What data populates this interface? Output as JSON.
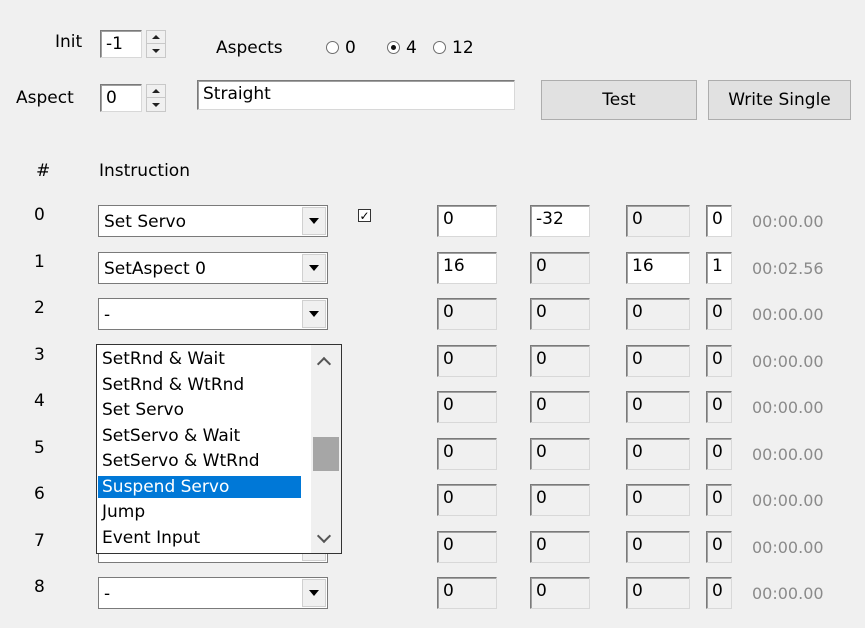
{
  "init": {
    "label": "Init",
    "value": "-1"
  },
  "aspects": {
    "label": "Aspects",
    "options": [
      {
        "label": "0",
        "selected": false
      },
      {
        "label": "4",
        "selected": true
      },
      {
        "label": "12",
        "selected": false
      }
    ]
  },
  "aspect": {
    "label": "Aspect",
    "value": "0",
    "name": "Straight"
  },
  "buttons": {
    "test": "Test",
    "write_single": "Write Single"
  },
  "headers": {
    "num": "#",
    "instruction": "Instruction"
  },
  "rows": [
    {
      "num": "0",
      "instruction": "Set Servo",
      "checkbox": true,
      "v1": "0",
      "v2": "-32",
      "v3": "0",
      "v4": "0",
      "v1_ro": false,
      "v2_ro": false,
      "v3_ro": true,
      "v4_ro": false,
      "time": "00:00.00"
    },
    {
      "num": "1",
      "instruction": "SetAspect 0",
      "checkbox": false,
      "v1": "16",
      "v2": "0",
      "v3": "16",
      "v4": "1",
      "v1_ro": false,
      "v2_ro": true,
      "v3_ro": false,
      "v4_ro": false,
      "time": "00:02.56"
    },
    {
      "num": "2",
      "instruction": "-",
      "checkbox": false,
      "v1": "0",
      "v2": "0",
      "v3": "0",
      "v4": "0",
      "v1_ro": true,
      "v2_ro": true,
      "v3_ro": true,
      "v4_ro": true,
      "time": "00:00.00"
    },
    {
      "num": "3",
      "instruction": "",
      "checkbox": false,
      "v1": "0",
      "v2": "0",
      "v3": "0",
      "v4": "0",
      "v1_ro": true,
      "v2_ro": true,
      "v3_ro": true,
      "v4_ro": true,
      "time": "00:00.00"
    },
    {
      "num": "4",
      "instruction": "",
      "checkbox": false,
      "v1": "0",
      "v2": "0",
      "v3": "0",
      "v4": "0",
      "v1_ro": true,
      "v2_ro": true,
      "v3_ro": true,
      "v4_ro": true,
      "time": "00:00.00"
    },
    {
      "num": "5",
      "instruction": "",
      "checkbox": false,
      "v1": "0",
      "v2": "0",
      "v3": "0",
      "v4": "0",
      "v1_ro": true,
      "v2_ro": true,
      "v3_ro": true,
      "v4_ro": true,
      "time": "00:00.00"
    },
    {
      "num": "6",
      "instruction": "",
      "checkbox": false,
      "v1": "0",
      "v2": "0",
      "v3": "0",
      "v4": "0",
      "v1_ro": true,
      "v2_ro": true,
      "v3_ro": true,
      "v4_ro": true,
      "time": "00:00.00"
    },
    {
      "num": "7",
      "instruction": "-",
      "checkbox": false,
      "v1": "0",
      "v2": "0",
      "v3": "0",
      "v4": "0",
      "v1_ro": true,
      "v2_ro": true,
      "v3_ro": true,
      "v4_ro": true,
      "time": "00:00.00"
    },
    {
      "num": "8",
      "instruction": "-",
      "checkbox": false,
      "v1": "0",
      "v2": "0",
      "v3": "0",
      "v4": "0",
      "v1_ro": true,
      "v2_ro": true,
      "v3_ro": true,
      "v4_ro": true,
      "time": "00:00.00"
    }
  ],
  "dropdown": {
    "items": [
      "SetRnd & Wait",
      "SetRnd & WtRnd",
      "Set Servo",
      "SetServo & Wait",
      "SetServo & WtRnd",
      "Suspend Servo",
      "Jump",
      "Event Input"
    ],
    "selected_index": 5
  }
}
